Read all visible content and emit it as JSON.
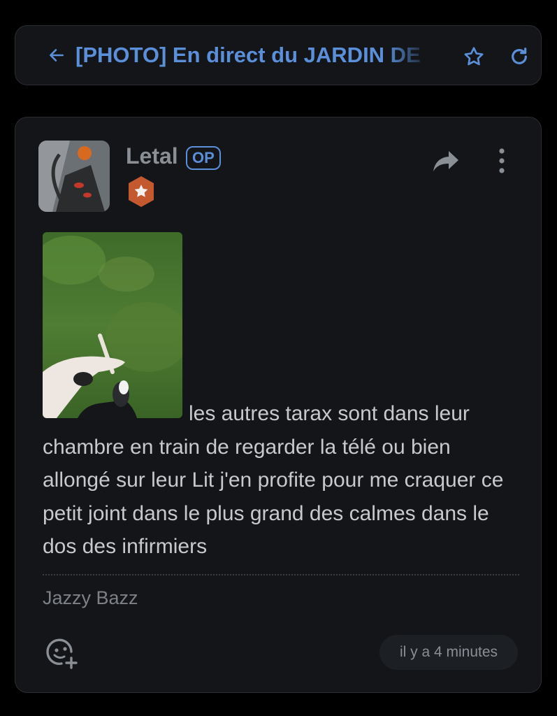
{
  "header": {
    "title": "[PHOTO] En direct du JARDIN DE",
    "back_icon": "arrow-left-icon",
    "favorite_icon": "star-icon",
    "refresh_icon": "refresh-icon",
    "accent_color": "#5b8fd9"
  },
  "post": {
    "author": "Letal",
    "op_label": "OP",
    "rank_badge_icon": "star-hexagon-badge-icon",
    "rank_badge_color": "#c4582e",
    "share_icon": "share-icon",
    "menu_icon": "more-vertical-icon",
    "body": "les autres tarax sont dans leur chambre en train de regarder la télé ou bien allongé sur leur Lit j'en profite pour me craquer ce petit joint dans le plus grand des calmes dans le dos des infirmiers",
    "signature": "Jazzy Bazz",
    "react_icon": "add-reaction-icon",
    "timestamp": "il y a 4 minutes"
  }
}
